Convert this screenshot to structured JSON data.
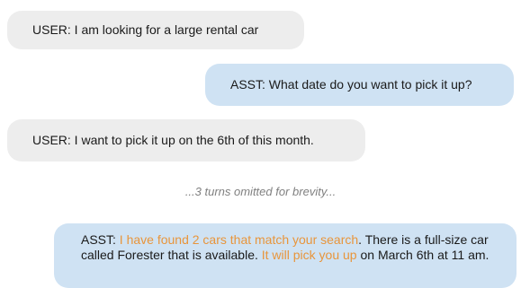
{
  "messages": [
    {
      "speaker": "USER",
      "text": "USER: I am looking for a large rental car"
    },
    {
      "speaker": "ASST",
      "text": "ASST: What date do you want to pick it up?"
    },
    {
      "speaker": "USER",
      "text": "USER: I want to pick it up on the 6th of this month."
    }
  ],
  "omitted_note": "...3 turns omitted for brevity...",
  "final_message": {
    "prefix": "ASST: ",
    "highlight_1": "I have found 2 cars that match your search",
    "part_2": ". There is a full-size car called Forester that is available. ",
    "highlight_2": "It will pick you up",
    "part_3": " on March 6th at 11 am."
  },
  "colors": {
    "user_bubble": "#ededed",
    "assistant_bubble": "#cfe2f3",
    "highlight": "#e8953b",
    "omitted_text": "#808080"
  }
}
